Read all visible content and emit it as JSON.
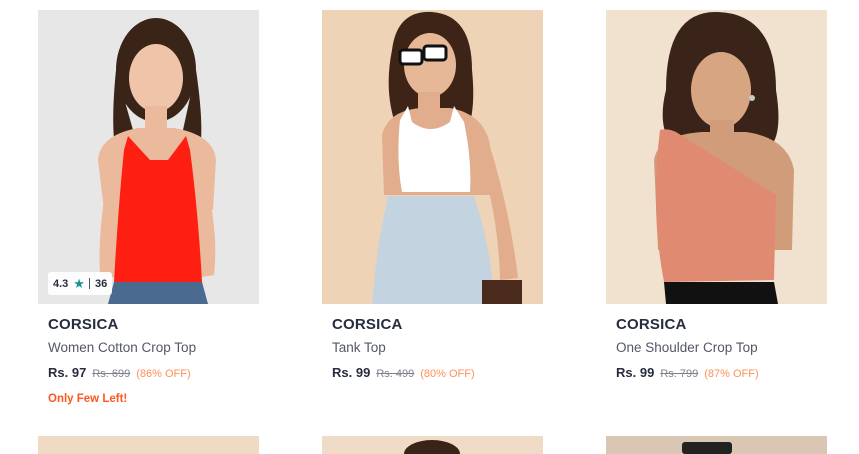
{
  "products": [
    {
      "brand": "CORSICA",
      "title": "Women Cotton Crop Top",
      "price": "Rs. 97",
      "mrp": "Rs. 699",
      "discount": "(86% OFF)",
      "rating": "4.3",
      "rating_count": "36",
      "urgency": "Only Few Left!",
      "top_color": "#ff1e12"
    },
    {
      "brand": "CORSICA",
      "title": "Tank Top",
      "price": "Rs. 99",
      "mrp": "Rs. 499",
      "discount": "(80% OFF)",
      "top_color": "#ffffff"
    },
    {
      "brand": "CORSICA",
      "title": "One Shoulder Crop Top",
      "price": "Rs. 99",
      "mrp": "Rs. 799",
      "discount": "(87% OFF)",
      "top_color": "#e08a72"
    }
  ],
  "colors": {
    "brand_text": "#282c3f",
    "discount": "#ff905a",
    "urgency": "#ff5722",
    "rating_star": "#14958f"
  }
}
